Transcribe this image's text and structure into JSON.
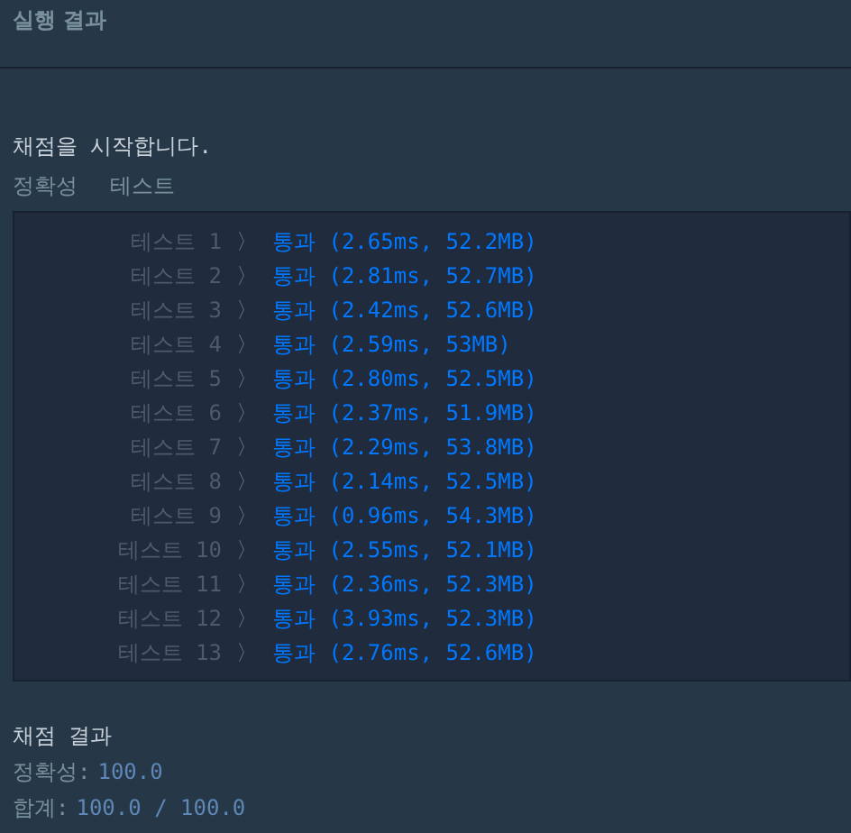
{
  "header": {
    "title": "실행 결과"
  },
  "console": {
    "start_message": "채점을 시작합니다.",
    "section_labels": [
      "정확성",
      "테스트"
    ],
    "tests": [
      {
        "label": "테스트 1",
        "separator": "〉",
        "result": "통과 (2.65ms, 52.2MB)"
      },
      {
        "label": "테스트 2",
        "separator": "〉",
        "result": "통과 (2.81ms, 52.7MB)"
      },
      {
        "label": "테스트 3",
        "separator": "〉",
        "result": "통과 (2.42ms, 52.6MB)"
      },
      {
        "label": "테스트 4",
        "separator": "〉",
        "result": "통과 (2.59ms, 53MB)"
      },
      {
        "label": "테스트 5",
        "separator": "〉",
        "result": "통과 (2.80ms, 52.5MB)"
      },
      {
        "label": "테스트 6",
        "separator": "〉",
        "result": "통과 (2.37ms, 51.9MB)"
      },
      {
        "label": "테스트 7",
        "separator": "〉",
        "result": "통과 (2.29ms, 53.8MB)"
      },
      {
        "label": "테스트 8",
        "separator": "〉",
        "result": "통과 (2.14ms, 52.5MB)"
      },
      {
        "label": "테스트 9",
        "separator": "〉",
        "result": "통과 (0.96ms, 54.3MB)"
      },
      {
        "label": "테스트 10",
        "separator": "〉",
        "result": "통과 (2.55ms, 52.1MB)"
      },
      {
        "label": "테스트 11",
        "separator": "〉",
        "result": "통과 (2.36ms, 52.3MB)"
      },
      {
        "label": "테스트 12",
        "separator": "〉",
        "result": "통과 (3.93ms, 52.3MB)"
      },
      {
        "label": "테스트 13",
        "separator": "〉",
        "result": "통과 (2.76ms, 52.6MB)"
      }
    ],
    "summary_title": "채점 결과",
    "summary": [
      {
        "label": "정확성:",
        "value": "100.0"
      },
      {
        "label": "합계:",
        "value": "100.0 / 100.0"
      }
    ]
  }
}
